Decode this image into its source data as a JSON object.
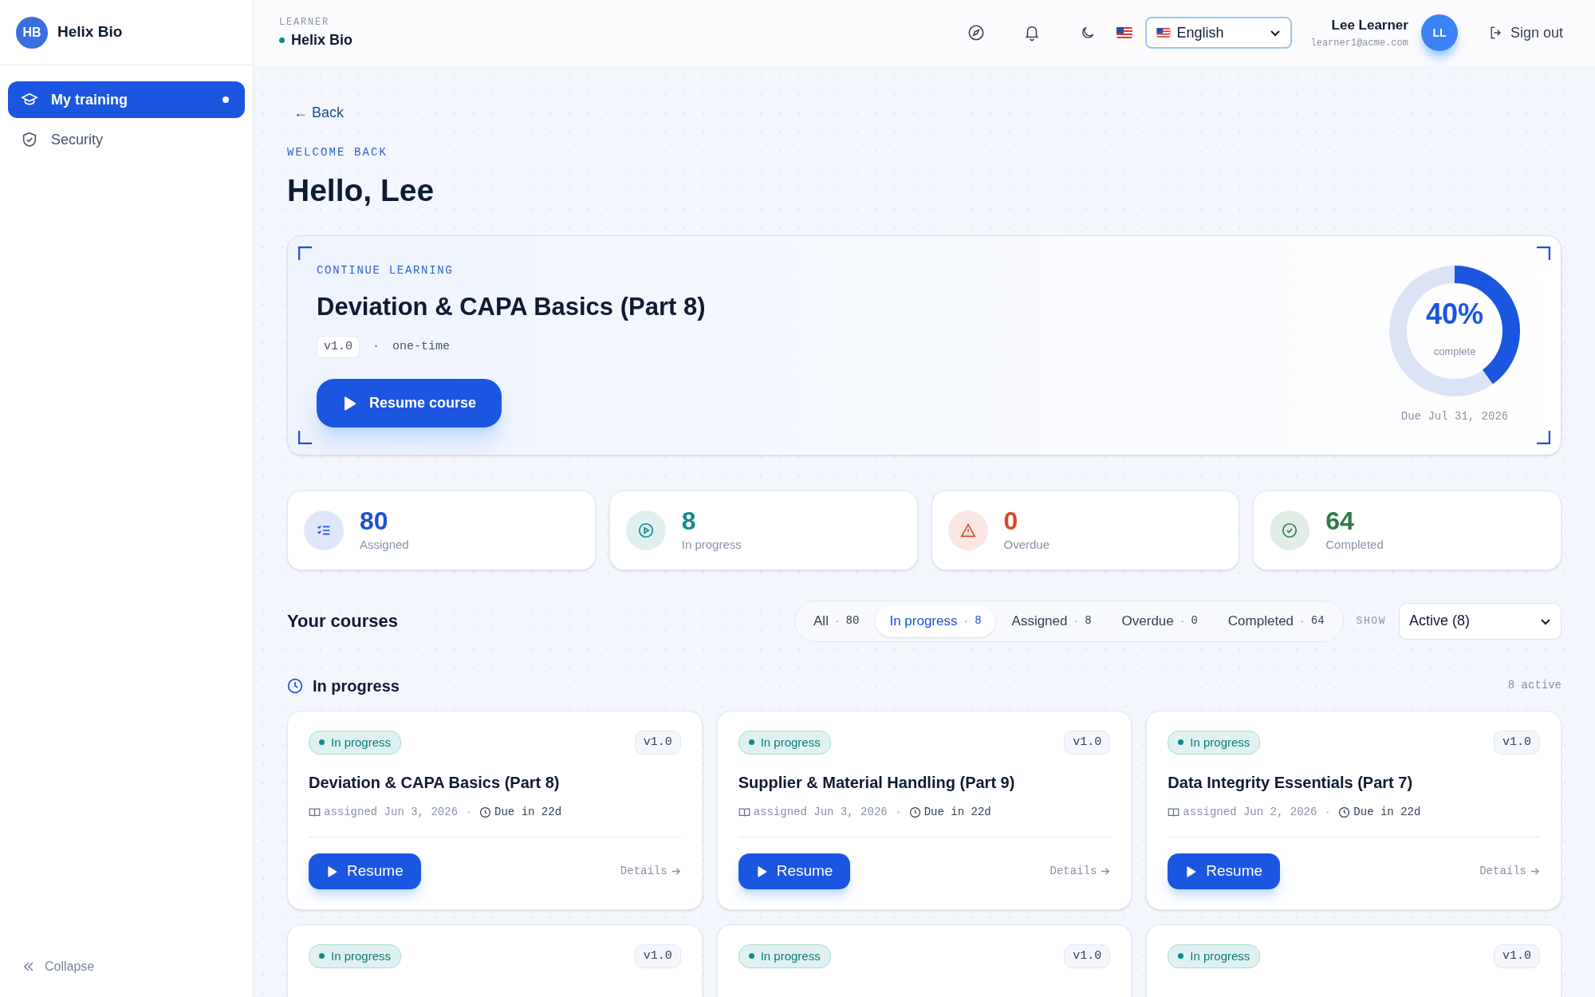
{
  "sidebar": {
    "logo": "HB",
    "brand": "Helix Bio",
    "items": [
      {
        "label": "My training",
        "kind": "training",
        "selected": true
      },
      {
        "label": "Security",
        "kind": "security",
        "selected": false
      }
    ],
    "collapse": "Collapse"
  },
  "header": {
    "role": "LEARNER",
    "org": "Helix Bio",
    "language": "English",
    "user_name": "Lee Learner",
    "user_email": "learner1@acme.com",
    "avatar": "LL",
    "sign_out": "Sign out"
  },
  "back": "← Back",
  "eyebrow": "WELCOME BACK",
  "greeting": "Hello, Lee",
  "hero": {
    "eyebrow": "CONTINUE LEARNING",
    "title": "Deviation & CAPA Basics (Part 8)",
    "version": "v1.0",
    "separator": "·",
    "frequency": "one-time",
    "button": "Resume course",
    "percent": "40%",
    "percent_label": "complete",
    "level": 0.4,
    "due": "Due Jul 31, 2026"
  },
  "stats": [
    {
      "value": "80",
      "label": "Assigned",
      "kind": "assigned",
      "color": "#1d4ed8"
    },
    {
      "value": "8",
      "label": "In progress",
      "kind": "progress",
      "color": "#0f8b8d"
    },
    {
      "value": "0",
      "label": "Overdue",
      "kind": "overdue",
      "color": "#d9482b"
    },
    {
      "value": "64",
      "label": "Completed",
      "kind": "completed",
      "color": "#2f7a4b"
    }
  ],
  "courses": {
    "title": "Your courses",
    "filters": [
      {
        "label": "All",
        "separator": "·",
        "count": "80",
        "selected": false
      },
      {
        "label": "In progress",
        "separator": "·",
        "count": "8",
        "selected": true
      },
      {
        "label": "Assigned",
        "separator": "·",
        "count": "8",
        "selected": false
      },
      {
        "label": "Overdue",
        "separator": "·",
        "count": "0",
        "selected": false
      },
      {
        "label": "Completed",
        "separator": "·",
        "count": "64",
        "selected": false
      }
    ],
    "show_label": "SHOW",
    "show_value": "Active (8)",
    "section": {
      "title": "In progress",
      "count": "8 active"
    },
    "cards": [
      {
        "status": "In progress",
        "version": "v1.0",
        "title": "Deviation & CAPA Basics (Part 8)",
        "assigned": "assigned Jun 3, 2026",
        "due": "Due in 22d",
        "button": "Resume",
        "details": "Details"
      },
      {
        "status": "In progress",
        "version": "v1.0",
        "title": "Supplier & Material Handling (Part 9)",
        "assigned": "assigned Jun 3, 2026",
        "due": "Due in 22d",
        "button": "Resume",
        "details": "Details"
      },
      {
        "status": "In progress",
        "version": "v1.0",
        "title": "Data Integrity Essentials (Part 7)",
        "assigned": "assigned Jun 2, 2026",
        "due": "Due in 22d",
        "button": "Resume",
        "details": "Details"
      },
      {
        "status": "In progress",
        "version": "v1.0"
      },
      {
        "status": "In progress",
        "version": "v1.0"
      },
      {
        "status": "In progress",
        "version": "v1.0"
      }
    ]
  }
}
